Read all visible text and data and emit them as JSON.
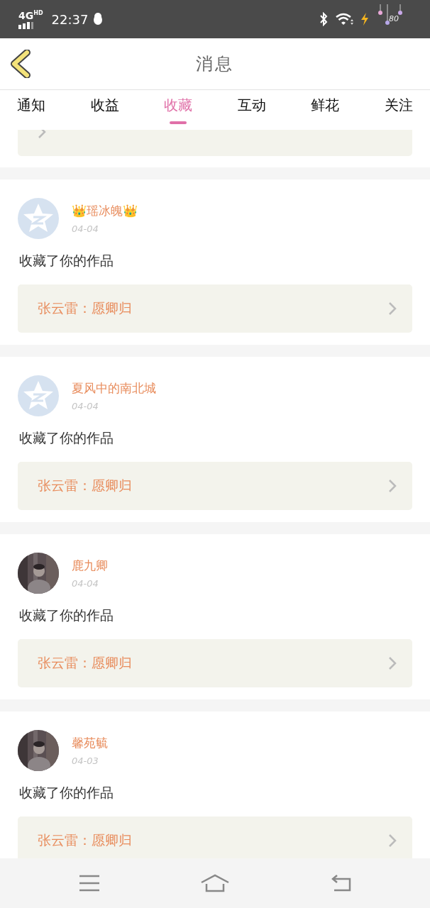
{
  "status_bar": {
    "network": "4G",
    "network_badge": "HD",
    "time": "22:37",
    "battery": "80"
  },
  "header": {
    "title": "消息"
  },
  "tabs": [
    {
      "label": "通知",
      "selected": false
    },
    {
      "label": "收益",
      "selected": false
    },
    {
      "label": "收藏",
      "selected": true
    },
    {
      "label": "互动",
      "selected": false
    },
    {
      "label": "鲜花",
      "selected": false
    },
    {
      "label": "关注",
      "selected": false
    }
  ],
  "items": [
    {
      "avatar": {
        "kind": "default"
      },
      "name": "👑瑶冰魄👑",
      "date": "04-04",
      "action": "收藏了你的作品",
      "quote": "张云雷：愿卿归"
    },
    {
      "avatar": {
        "kind": "default"
      },
      "name": "夏风中的南北城",
      "date": "04-04",
      "action": "收藏了你的作品",
      "quote": "张云雷：愿卿归"
    },
    {
      "name": "鹿九卿",
      "date": "04-04",
      "action": "收藏了你的作品",
      "quote": "张云雷：愿卿归"
    },
    {
      "name": "馨苑毓",
      "date": "04-03",
      "action": "收藏了你的作品",
      "quote": "张云雷：愿卿归"
    }
  ]
}
